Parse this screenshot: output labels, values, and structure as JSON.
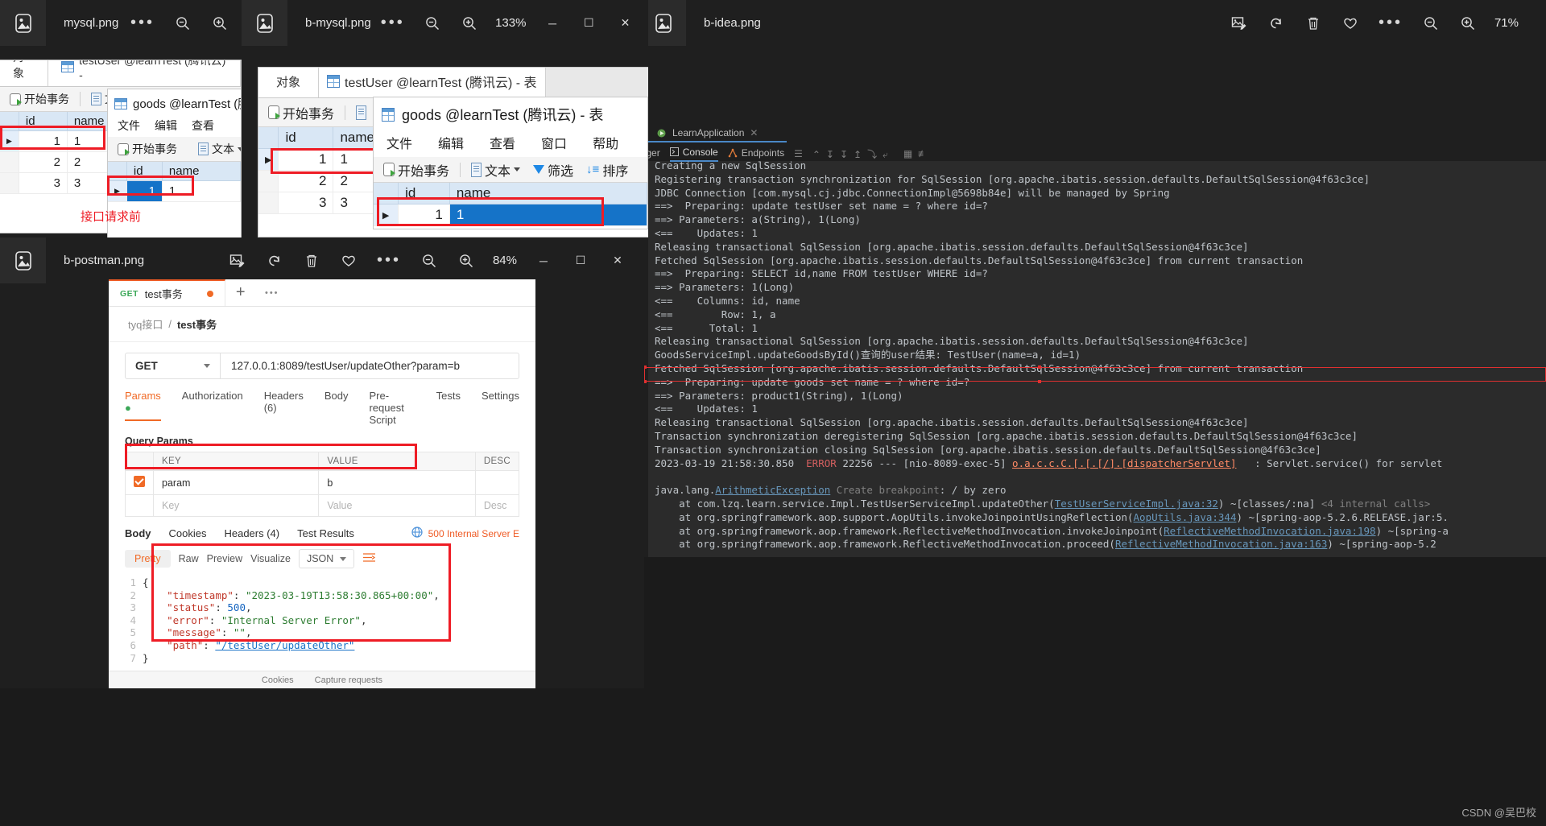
{
  "windows": {
    "mysql": {
      "title": "mysql.png",
      "controls": {
        "more": "•••",
        "zoom_out": "zoom-out-icon",
        "zoom_in": "zoom-in-icon"
      },
      "navicat": {
        "tab_objects": "对象",
        "tab_table": "testUser @learnTest (腾讯云) -",
        "toolbar": {
          "begin_transaction": "开始事务",
          "text": "文"
        },
        "columns": [
          "id",
          "name"
        ],
        "rows": [
          {
            "id": "1",
            "name": "1",
            "current": true
          },
          {
            "id": "2",
            "name": "2",
            "current": false
          },
          {
            "id": "3",
            "name": "3",
            "current": false
          }
        ],
        "goods": {
          "title": "goods @learnTest (腾",
          "menus": [
            "文件",
            "编辑",
            "查看"
          ],
          "toolbar": {
            "begin_transaction": "开始事务",
            "text": "文本"
          },
          "columns": [
            "id",
            "name"
          ],
          "rows": [
            {
              "id": "1",
              "name": "1",
              "selected": true
            }
          ]
        },
        "annotation": "接口请求前"
      }
    },
    "bmysql": {
      "title": "b-mysql.png",
      "zoom_level": "133%",
      "controls": {
        "more": "•••",
        "minimize": "─",
        "maximize": "☐",
        "close": "✕"
      },
      "navicat": {
        "tab_objects": "对象",
        "tab_table": "testUser @learnTest (腾讯云) - 表",
        "toolbar": {
          "begin_transaction": "开始事务"
        },
        "columns": [
          "id",
          "name"
        ],
        "rows": [
          {
            "id": "1",
            "name": "1",
            "current": true
          },
          {
            "id": "2",
            "name": "2",
            "current": false
          },
          {
            "id": "3",
            "name": "3",
            "current": false
          }
        ],
        "goods": {
          "title": "goods @learnTest (腾讯云) - 表",
          "menus": [
            "文件",
            "编辑",
            "查看",
            "窗口",
            "帮助"
          ],
          "toolbar": {
            "begin_transaction": "开始事务",
            "text": "文本",
            "filter": "筛选",
            "sort": "排序"
          },
          "columns": [
            "id",
            "name"
          ],
          "rows": [
            {
              "id": "1",
              "name": "1",
              "selected": true
            }
          ]
        }
      }
    },
    "bidea": {
      "title": "b-idea.png",
      "zoom_level": "71%",
      "controls": {
        "edit": "edit-image-icon",
        "rotate": "rotate-icon",
        "delete": "delete-icon",
        "favorite": "heart-icon",
        "more": "•••",
        "zoom_out": "zoom-out-icon",
        "zoom_in": "zoom-in-icon"
      },
      "idea": {
        "run_tab": "LearnApplication",
        "tabs": [
          "ugger",
          "Console",
          "Endpoints"
        ],
        "active_tab": "Console",
        "console_lines": [
          {
            "t": "Creating a new SqlSession"
          },
          {
            "t": "Registering transaction synchronization for SqlSession [org.apache.ibatis.session.defaults.DefaultSqlSession@4f63c3ce]"
          },
          {
            "t": "JDBC Connection [com.mysql.cj.jdbc.ConnectionImpl@5698b84e] will be managed by Spring"
          },
          {
            "t": "==>  Preparing: update testUser set name = ? where id=?"
          },
          {
            "t": "==> Parameters: a(String), 1(Long)"
          },
          {
            "t": "<==    Updates: 1"
          },
          {
            "t": "Releasing transactional SqlSession [org.apache.ibatis.session.defaults.DefaultSqlSession@4f63c3ce]"
          },
          {
            "t": "Fetched SqlSession [org.apache.ibatis.session.defaults.DefaultSqlSession@4f63c3ce] from current transaction"
          },
          {
            "t": "==>  Preparing: SELECT id,name FROM testUser WHERE id=?"
          },
          {
            "t": "==> Parameters: 1(Long)"
          },
          {
            "t": "<==    Columns: id, name"
          },
          {
            "t": "<==        Row: 1, a"
          },
          {
            "t": "<==      Total: 1"
          },
          {
            "t": "Releasing transactional SqlSession [org.apache.ibatis.session.defaults.DefaultSqlSession@4f63c3ce]"
          },
          {
            "t": "GoodsServiceImpl.updateGoodsById()查询的user结果: TestUser(name=a, id=1)",
            "highlight": true
          },
          {
            "t": "Fetched SqlSession [org.apache.ibatis.session.defaults.DefaultSqlSession@4f63c3ce] from current transaction"
          },
          {
            "t": "==>  Preparing: update goods set name = ? where id=?"
          },
          {
            "t": "==> Parameters: product1(String), 1(Long)"
          },
          {
            "t": "<==    Updates: 1"
          },
          {
            "t": "Releasing transactional SqlSession [org.apache.ibatis.session.defaults.DefaultSqlSession@4f63c3ce]"
          },
          {
            "t": "Transaction synchronization deregistering SqlSession [org.apache.ibatis.session.defaults.DefaultSqlSession@4f63c3ce]"
          },
          {
            "t": "Transaction synchronization closing SqlSession [org.apache.ibatis.session.defaults.DefaultSqlSession@4f63c3ce]"
          }
        ],
        "error_line": {
          "timestamp": "2023-03-19 21:58:30.850",
          "level": "ERROR",
          "pid": "22256",
          "sep": "---",
          "thread": "[nio-8089-exec-5]",
          "logger": "o.a.c.c.C.[.[.[/].[dispatcherServlet]",
          "message": ": Servlet.service() for servlet"
        },
        "stack": [
          {
            "pre": "java.lang.",
            "link": "ArithmeticException",
            "hint": "Create breakpoint",
            "post": ": / by zero"
          },
          {
            "pre": "    at com.lzq.learn.service.Impl.TestUserServiceImpl.updateOther(",
            "link": "TestUserServiceImpl.java:32",
            "post": ") ~[classes/:na]",
            "tail": "<4 internal calls>"
          },
          {
            "pre": "    at org.springframework.aop.support.AopUtils.invokeJoinpointUsingReflection(",
            "link": "AopUtils.java:344",
            "post": ") ~[spring-aop-5.2.6.RELEASE.jar:5."
          },
          {
            "pre": "    at org.springframework.aop.framework.ReflectiveMethodInvocation.invokeJoinpoint(",
            "link": "ReflectiveMethodInvocation.java:198",
            "post": ") ~[spring-a"
          },
          {
            "pre": "    at org.springframework.aop.framework.ReflectiveMethodInvocation.proceed(",
            "link": "ReflectiveMethodInvocation.java:163",
            "post": ") ~[spring-aop-5.2"
          }
        ]
      }
    },
    "bpostman": {
      "title": "b-postman.png",
      "zoom_level": "84%",
      "controls": {
        "edit": "edit-image-icon",
        "rotate": "rotate-icon",
        "delete": "delete-icon",
        "favorite": "heart-icon",
        "more": "•••",
        "zoom_out": "zoom-out-icon",
        "zoom_in": "zoom-in-icon",
        "minimize": "─",
        "maximize": "☐",
        "close": "✕"
      },
      "postman": {
        "tab": {
          "method": "GET",
          "name": "test事务"
        },
        "new_tab": "+",
        "tab_more": "•••",
        "breadcrumb": {
          "collection": "tyq接口",
          "sep": "/",
          "request": "test事务"
        },
        "method": "GET",
        "url": "127.0.0.1:8089/testUser/updateOther?param=b",
        "req_tabs": [
          "Params",
          "Authorization",
          "Headers (6)",
          "Body",
          "Pre-request Script",
          "Tests",
          "Settings"
        ],
        "req_tab_active": "Params",
        "query_params_label": "Query Params",
        "param_headers": [
          "KEY",
          "VALUE",
          "DESC"
        ],
        "param_rows": [
          {
            "checked": true,
            "key": "param",
            "value": "b",
            "desc": ""
          }
        ],
        "param_placeholder": {
          "key": "Key",
          "value": "Value",
          "desc": "Desc"
        },
        "res_tabs": [
          "Body",
          "Cookies",
          "Headers (4)",
          "Test Results"
        ],
        "res_tab_active": "Body",
        "status": "500 Internal Server E",
        "view_modes": [
          "Pretty",
          "Raw",
          "Preview",
          "Visualize"
        ],
        "view_active": "Pretty",
        "format": "JSON",
        "body_lines": [
          {
            "n": "1",
            "text": "{"
          },
          {
            "n": "2",
            "key": "\"timestamp\"",
            "val": "\"2023-03-19T13:58:30.865+00:00\"",
            "comma": ","
          },
          {
            "n": "3",
            "key": "\"status\"",
            "num": "500",
            "comma": ","
          },
          {
            "n": "4",
            "key": "\"error\"",
            "val": "\"Internal Server Error\"",
            "comma": ","
          },
          {
            "n": "5",
            "key": "\"message\"",
            "val": "\"\"",
            "comma": ","
          },
          {
            "n": "6",
            "key": "\"path\"",
            "link": "\"/testUser/updateOther\""
          },
          {
            "n": "7",
            "text": "}"
          }
        ],
        "bottom_bar": [
          "Cookies",
          "Capture requests"
        ]
      }
    }
  },
  "watermark": "CSDN @吴巴校"
}
